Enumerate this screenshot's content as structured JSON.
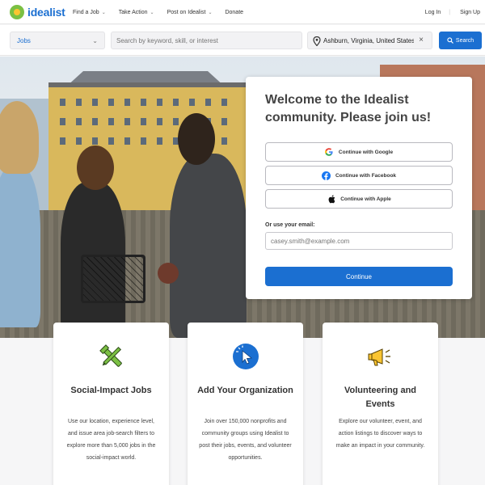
{
  "brand": {
    "name": "idealist",
    "colors": {
      "primary": "#1b6fd1",
      "logo_green": "#7bc043",
      "logo_yellow": "#fbc531"
    }
  },
  "nav": {
    "items": [
      {
        "label": "Find a Job",
        "has_dropdown": true
      },
      {
        "label": "Take Action",
        "has_dropdown": true
      },
      {
        "label": "Post on Idealist",
        "has_dropdown": true
      },
      {
        "label": "Donate",
        "has_dropdown": false
      }
    ],
    "login": "Log In",
    "signup": "Sign Up"
  },
  "search": {
    "category": "Jobs",
    "keyword_placeholder": "Search by keyword, skill, or interest",
    "location": "Ashburn, Virginia, United States",
    "button": "Search"
  },
  "signup": {
    "title": "Welcome to the Idealist community. Please join us!",
    "google": "Continue with Google",
    "facebook": "Continue with Facebook",
    "apple": "Continue with Apple",
    "email_label": "Or use your email:",
    "email_placeholder": "casey.smith@example.com",
    "continue": "Continue"
  },
  "features": [
    {
      "icon": "tools-icon",
      "title": "Social-Impact Jobs",
      "desc": "Use our location, experience level, and issue area job-search filters to explore more than 5,000 jobs in the social-impact world."
    },
    {
      "icon": "cursor-click-icon",
      "title": "Add Your Organization",
      "desc": "Join over 150,000 nonprofits and community groups using Idealist to post their jobs, events, and volunteer opportunities."
    },
    {
      "icon": "megaphone-icon",
      "title": "Volunteering and Events",
      "desc": "Explore our volunteer, event, and action listings to discover ways to make an impact in your community."
    }
  ]
}
